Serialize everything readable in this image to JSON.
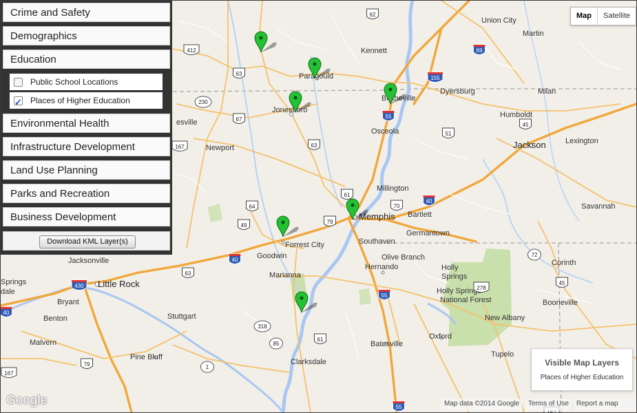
{
  "sidebar": {
    "categories": [
      {
        "label": "Crime and Safety"
      },
      {
        "label": "Demographics"
      },
      {
        "label": "Education"
      },
      {
        "label": "Environmental Health"
      },
      {
        "label": "Infrastructure Development"
      },
      {
        "label": "Land Use Planning"
      },
      {
        "label": "Parks and Recreation"
      },
      {
        "label": "Business Development"
      }
    ],
    "education_layers": [
      {
        "label": "Public School Locations",
        "checked": false
      },
      {
        "label": "Places of Higher Education",
        "checked": true
      }
    ],
    "download_label": "Download KML Layer(s)"
  },
  "map_type": {
    "map_label": "Map",
    "satellite_label": "Satellite",
    "selected": "Map"
  },
  "legend": {
    "title": "Visible Map Layers",
    "items": [
      "Places of Higher Education"
    ]
  },
  "attribution": {
    "data": "Map data ©2014 Google",
    "terms": "Terms of Use",
    "report": "Report a map error",
    "logo": "Google"
  },
  "colors": {
    "marker": "#22c233",
    "highway": "#f1a73a",
    "water": "#a9c7f2",
    "land": "#f2efe9",
    "park": "#c9dfac"
  },
  "cities": {
    "union_city": "Union City",
    "martin": "Martin",
    "kennett": "Kennett",
    "paragould": "Paragould",
    "blytheville": "Blytheville",
    "dyersburg": "Dyersburg",
    "jonesboro": "Jonesboro",
    "humboldt": "Humboldt",
    "milan": "Milan",
    "osceola": "Osceola",
    "jackson": "Jackson",
    "lexington": "Lexington",
    "newport": "Newport",
    "millington": "Millington",
    "bartlett": "Bartlett",
    "memphis": "Memphis",
    "germantown": "Germantown",
    "savannah": "Savannah",
    "forrest_city": "Forrest City",
    "southaven": "Southaven",
    "goodwin": "Goodwin",
    "olive_branch": "Olive Branch",
    "jacksonville": "Jacksonville",
    "hernando": "Hernando",
    "corinth": "Corinth",
    "holly_springs": "Holly",
    "holly_springs2": "Springs",
    "marianna": "Marianna",
    "little_rock": "Little Rock",
    "springs": "Springs",
    "dale": "dale",
    "bryant": "Bryant",
    "hsnf1": "Holly Springs",
    "hsnf2": "National Forest",
    "booneville": "Booneville",
    "benton": "Benton",
    "stuttgart": "Stuttgart",
    "new_albany": "New Albany",
    "malvern": "Malvern",
    "oxford": "Oxford",
    "batesville": "Batesville",
    "pine_bluff": "Pine Bluff",
    "clarksdale": "Clarksdale",
    "tupelo": "Tupelo",
    "esville": "esville"
  },
  "shields": {
    "s62": "62",
    "s412": "412",
    "s63a": "63",
    "i69": "69",
    "s230": "230",
    "i155": "155",
    "s67": "67",
    "i55a": "55",
    "s167": "167",
    "s63b": "63",
    "s51": "51",
    "s45": "45",
    "s61a": "61",
    "s64": "64",
    "s70": "70",
    "i40a": "40",
    "s79": "79",
    "s49": "49",
    "s72": "72",
    "i40b": "40",
    "s63c": "63",
    "i430": "430",
    "i40c": "40",
    "i55b": "55",
    "s45b": "45",
    "s278": "278",
    "s318": "318",
    "s85": "85",
    "s61b": "61",
    "s79b": "79",
    "i55c": "55",
    "s1": "1",
    "s167b": "167",
    "s70b": "70",
    "s167c": "167"
  }
}
